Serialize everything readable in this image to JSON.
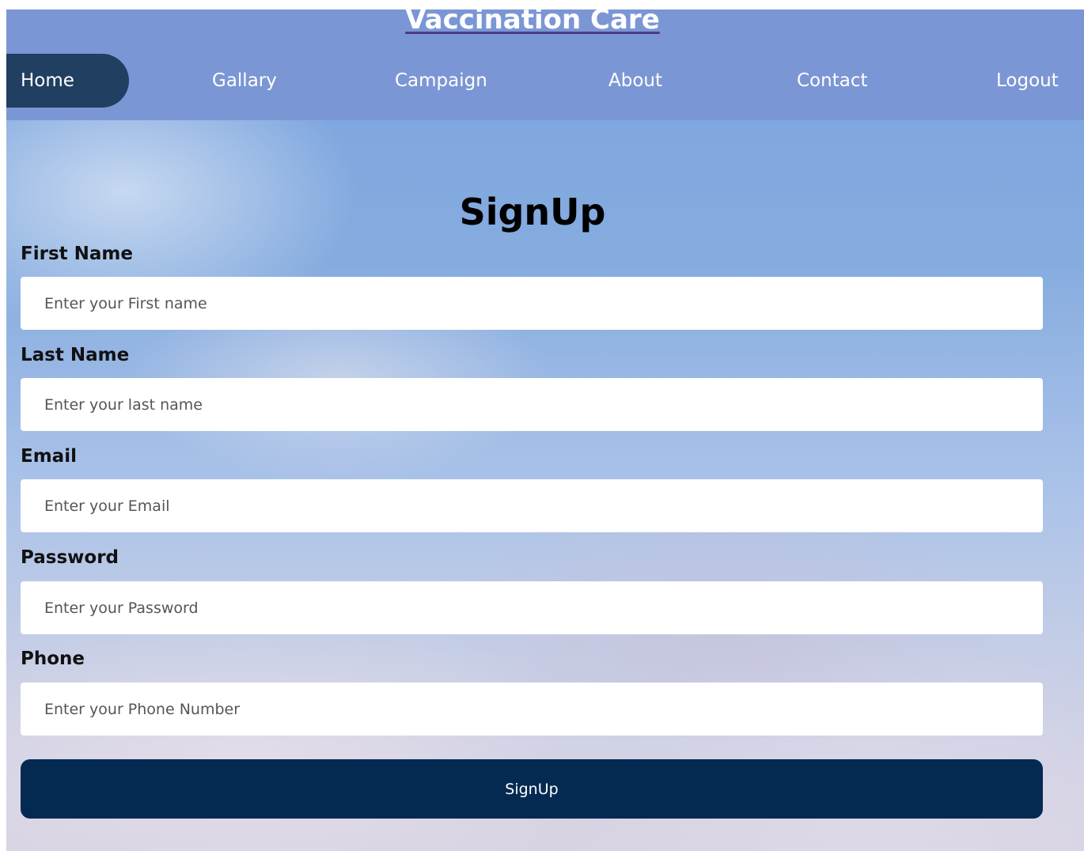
{
  "header": {
    "site_title": "Vaccination Care",
    "nav": [
      {
        "label": "Home",
        "active": true
      },
      {
        "label": "Gallary"
      },
      {
        "label": "Campaign"
      },
      {
        "label": "About"
      },
      {
        "label": "Contact"
      },
      {
        "label": "Logout"
      }
    ]
  },
  "form": {
    "title": "SignUp",
    "fields": [
      {
        "label": "First Name",
        "placeholder": "Enter your First name",
        "value": ""
      },
      {
        "label": "Last Name",
        "placeholder": "Enter your last name",
        "value": ""
      },
      {
        "label": "Email",
        "placeholder": "Enter your Email",
        "value": ""
      },
      {
        "label": "Password",
        "placeholder": "Enter your Password",
        "value": ""
      },
      {
        "label": "Phone",
        "placeholder": "Enter your Phone Number",
        "value": ""
      }
    ],
    "submit_label": "SignUp"
  },
  "colors": {
    "header_bg": "#7b96d4",
    "nav_active_bg": "#203f61",
    "button_bg": "#052a52"
  }
}
